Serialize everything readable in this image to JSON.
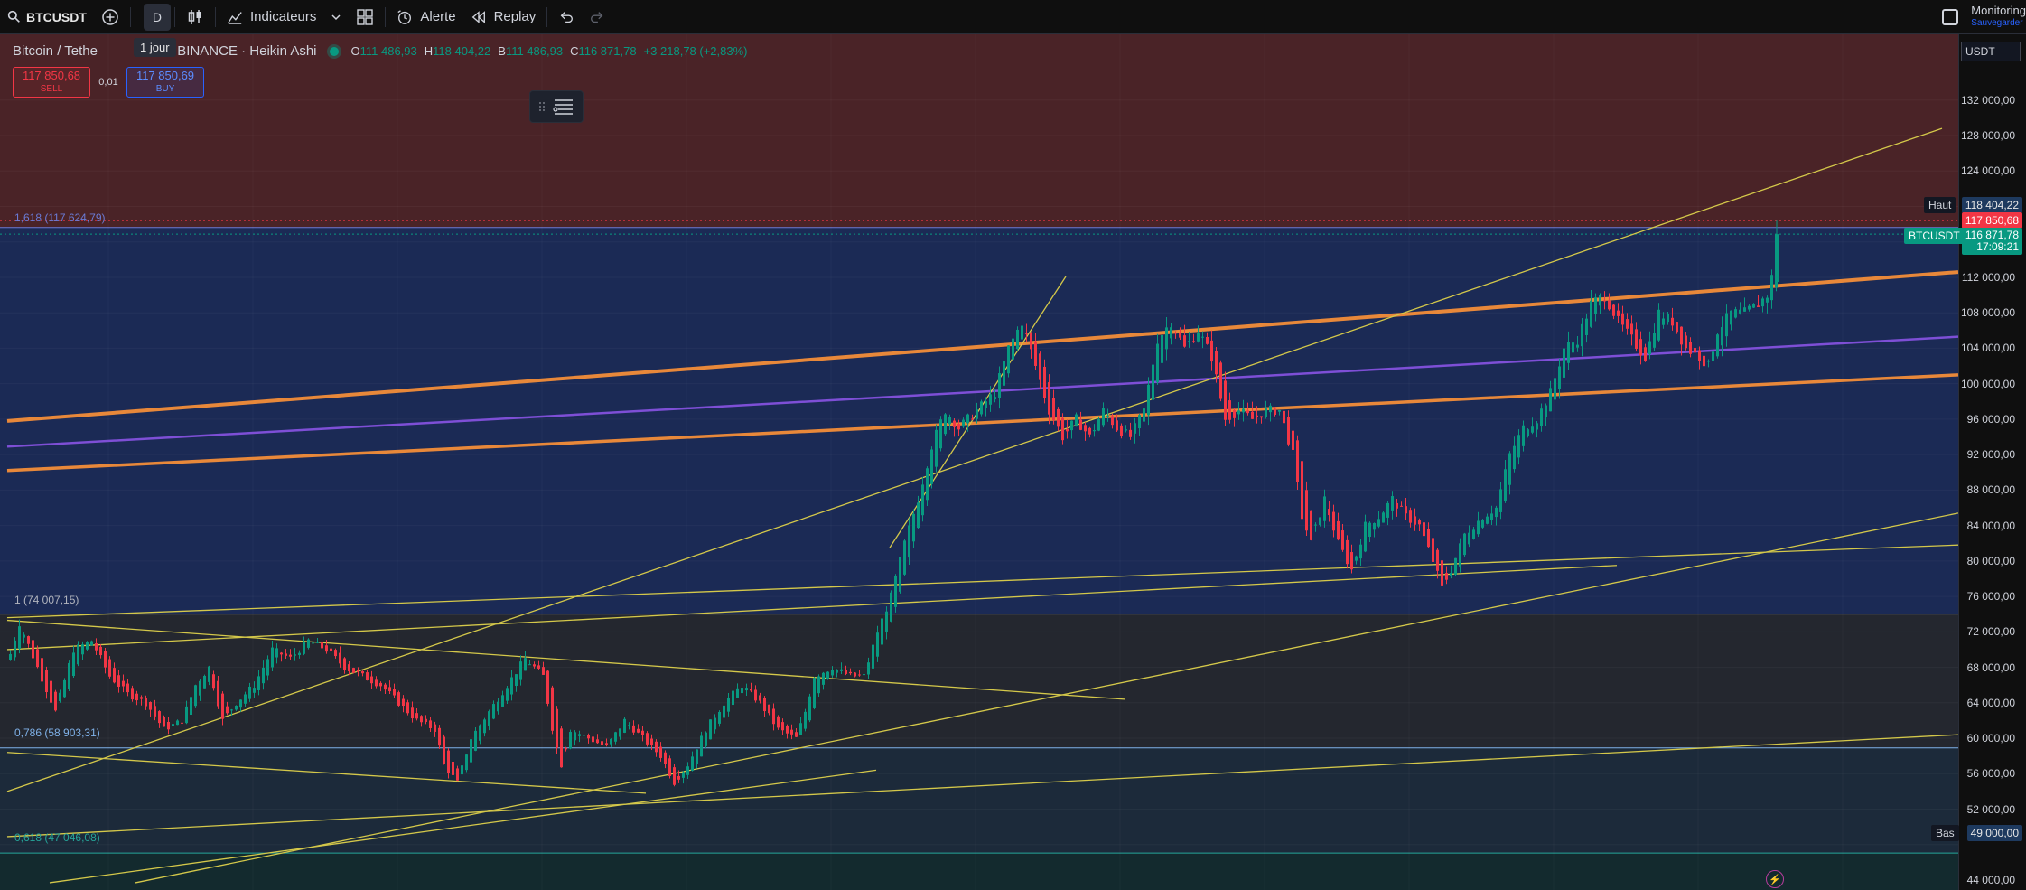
{
  "toolbar": {
    "symbol": "BTCUSDT",
    "interval": "D",
    "indicators_label": "Indicateurs",
    "alert_label": "Alerte",
    "replay_label": "Replay",
    "monitoring_label": "Monitoring",
    "save_label": "Sauvegarder"
  },
  "tooltip": "1 jour",
  "legend": {
    "title": "Bitcoin / Tethe",
    "title_suffix": "D · BINANCE · Heikin Ashi",
    "open_label": "O",
    "open": "111 486,93",
    "high_label": "H",
    "high": "118 404,22",
    "low_label": "B",
    "low": "111 486,93",
    "close_label": "C",
    "close": "116 871,78",
    "change": "+3 218,78 (+2,83%)"
  },
  "trade": {
    "sell_price": "117 850,68",
    "sell_label": "SELL",
    "spread": "0,01",
    "buy_price": "117 850,69",
    "buy_label": "BUY"
  },
  "fib": {
    "f1618": "1,618 (117 624,79)",
    "f1": "1 (74 007,15)",
    "f0786": "0,786 (58 903,31)",
    "f0618": "0,618 (47 046,08)"
  },
  "price_axis": {
    "currency": "USDT",
    "ticks": [
      "132 000,00",
      "128 000,00",
      "124 000,00",
      "112 000,00",
      "108 000,00",
      "104 000,00",
      "100 000,00",
      "96 000,00",
      "92 000,00",
      "88 000,00",
      "84 000,00",
      "80 000,00",
      "76 000,00",
      "72 000,00",
      "68 000,00",
      "64 000,00",
      "60 000,00",
      "56 000,00",
      "52 000,00",
      "44 000,00"
    ],
    "high_tag_label": "Haut",
    "high_tag_value": "118 404,22",
    "ask_tag": "117 850,68",
    "symbol_tag": "BTCUSDT",
    "last_price": "116 871,78",
    "countdown": "17:09:21",
    "low_tag_label": "Bas",
    "low_tag_value": "49 000,00"
  },
  "colors": {
    "up": "#089981",
    "down": "#f23645",
    "zone_top": "#4a2327",
    "zone_mid": "#1b2a55",
    "zone_low": "#24272f",
    "channel": "#e8883a",
    "midline": "#7e4fd6",
    "trend": "#d4c84a"
  },
  "chart_data": {
    "type": "candlestick",
    "title": "Bitcoin / Tethe",
    "ylim": [
      44000,
      134000
    ],
    "last_close": 116871.78,
    "high": 118404.22,
    "fib_levels": [
      117624.79,
      74007.15,
      58903.31,
      47046.08
    ],
    "price_path": [
      [
        0,
        66000
      ],
      [
        20,
        73000
      ],
      [
        40,
        68000
      ],
      [
        60,
        63000
      ],
      [
        80,
        70000
      ],
      [
        100,
        71000
      ],
      [
        120,
        67000
      ],
      [
        140,
        65000
      ],
      [
        160,
        64000
      ],
      [
        180,
        61000
      ],
      [
        200,
        62000
      ],
      [
        215,
        66000
      ],
      [
        230,
        68000
      ],
      [
        245,
        62000
      ],
      [
        260,
        64000
      ],
      [
        280,
        66000
      ],
      [
        300,
        70000
      ],
      [
        320,
        69000
      ],
      [
        340,
        71000
      ],
      [
        360,
        70000
      ],
      [
        380,
        68000
      ],
      [
        400,
        67000
      ],
      [
        420,
        66000
      ],
      [
        440,
        64000
      ],
      [
        460,
        62000
      ],
      [
        480,
        61000
      ],
      [
        490,
        57000
      ],
      [
        505,
        55000
      ],
      [
        520,
        60000
      ],
      [
        540,
        63000
      ],
      [
        560,
        66000
      ],
      [
        580,
        69000
      ],
      [
        600,
        67000
      ],
      [
        612,
        60000
      ],
      [
        620,
        57000
      ],
      [
        630,
        61000
      ],
      [
        650,
        60000
      ],
      [
        670,
        59000
      ],
      [
        690,
        62000
      ],
      [
        710,
        60000
      ],
      [
        730,
        58000
      ],
      [
        745,
        55000
      ],
      [
        760,
        57000
      ],
      [
        780,
        61000
      ],
      [
        800,
        64000
      ],
      [
        820,
        66000
      ],
      [
        840,
        64000
      ],
      [
        860,
        61000
      ],
      [
        880,
        60000
      ],
      [
        890,
        63000
      ],
      [
        900,
        67000
      ],
      [
        920,
        68000
      ],
      [
        940,
        67000
      ],
      [
        955,
        67000
      ],
      [
        970,
        72000
      ],
      [
        985,
        76000
      ],
      [
        1000,
        82000
      ],
      [
        1015,
        87000
      ],
      [
        1030,
        93000
      ],
      [
        1045,
        97000
      ],
      [
        1060,
        95000
      ],
      [
        1080,
        97000
      ],
      [
        1100,
        99000
      ],
      [
        1115,
        104000
      ],
      [
        1130,
        107000
      ],
      [
        1145,
        102000
      ],
      [
        1160,
        97000
      ],
      [
        1175,
        94000
      ],
      [
        1190,
        96000
      ],
      [
        1205,
        94000
      ],
      [
        1220,
        97000
      ],
      [
        1235,
        95000
      ],
      [
        1250,
        94000
      ],
      [
        1265,
        97000
      ],
      [
        1280,
        105000
      ],
      [
        1295,
        107000
      ],
      [
        1310,
        104000
      ],
      [
        1325,
        106000
      ],
      [
        1340,
        103000
      ],
      [
        1355,
        96000
      ],
      [
        1370,
        97000
      ],
      [
        1385,
        96000
      ],
      [
        1400,
        97000
      ],
      [
        1415,
        97000
      ],
      [
        1430,
        92000
      ],
      [
        1440,
        85000
      ],
      [
        1450,
        82000
      ],
      [
        1465,
        87000
      ],
      [
        1480,
        82000
      ],
      [
        1495,
        79000
      ],
      [
        1510,
        84000
      ],
      [
        1525,
        85000
      ],
      [
        1540,
        87000
      ],
      [
        1555,
        85000
      ],
      [
        1570,
        84000
      ],
      [
        1585,
        80000
      ],
      [
        1595,
        77000
      ],
      [
        1605,
        79000
      ],
      [
        1620,
        83000
      ],
      [
        1640,
        85000
      ],
      [
        1655,
        86000
      ],
      [
        1670,
        92000
      ],
      [
        1685,
        95000
      ],
      [
        1700,
        96000
      ],
      [
        1715,
        99000
      ],
      [
        1730,
        104000
      ],
      [
        1745,
        105000
      ],
      [
        1760,
        109000
      ],
      [
        1775,
        110000
      ],
      [
        1790,
        107000
      ],
      [
        1805,
        105000
      ],
      [
        1820,
        103000
      ],
      [
        1835,
        108000
      ],
      [
        1850,
        107000
      ],
      [
        1865,
        104000
      ],
      [
        1880,
        103000
      ],
      [
        1890,
        102000
      ],
      [
        1900,
        106000
      ],
      [
        1915,
        108000
      ],
      [
        1930,
        108000
      ],
      [
        1945,
        109000
      ],
      [
        1955,
        110000
      ],
      [
        1965,
        114000
      ],
      [
        1970,
        116872
      ]
    ]
  }
}
